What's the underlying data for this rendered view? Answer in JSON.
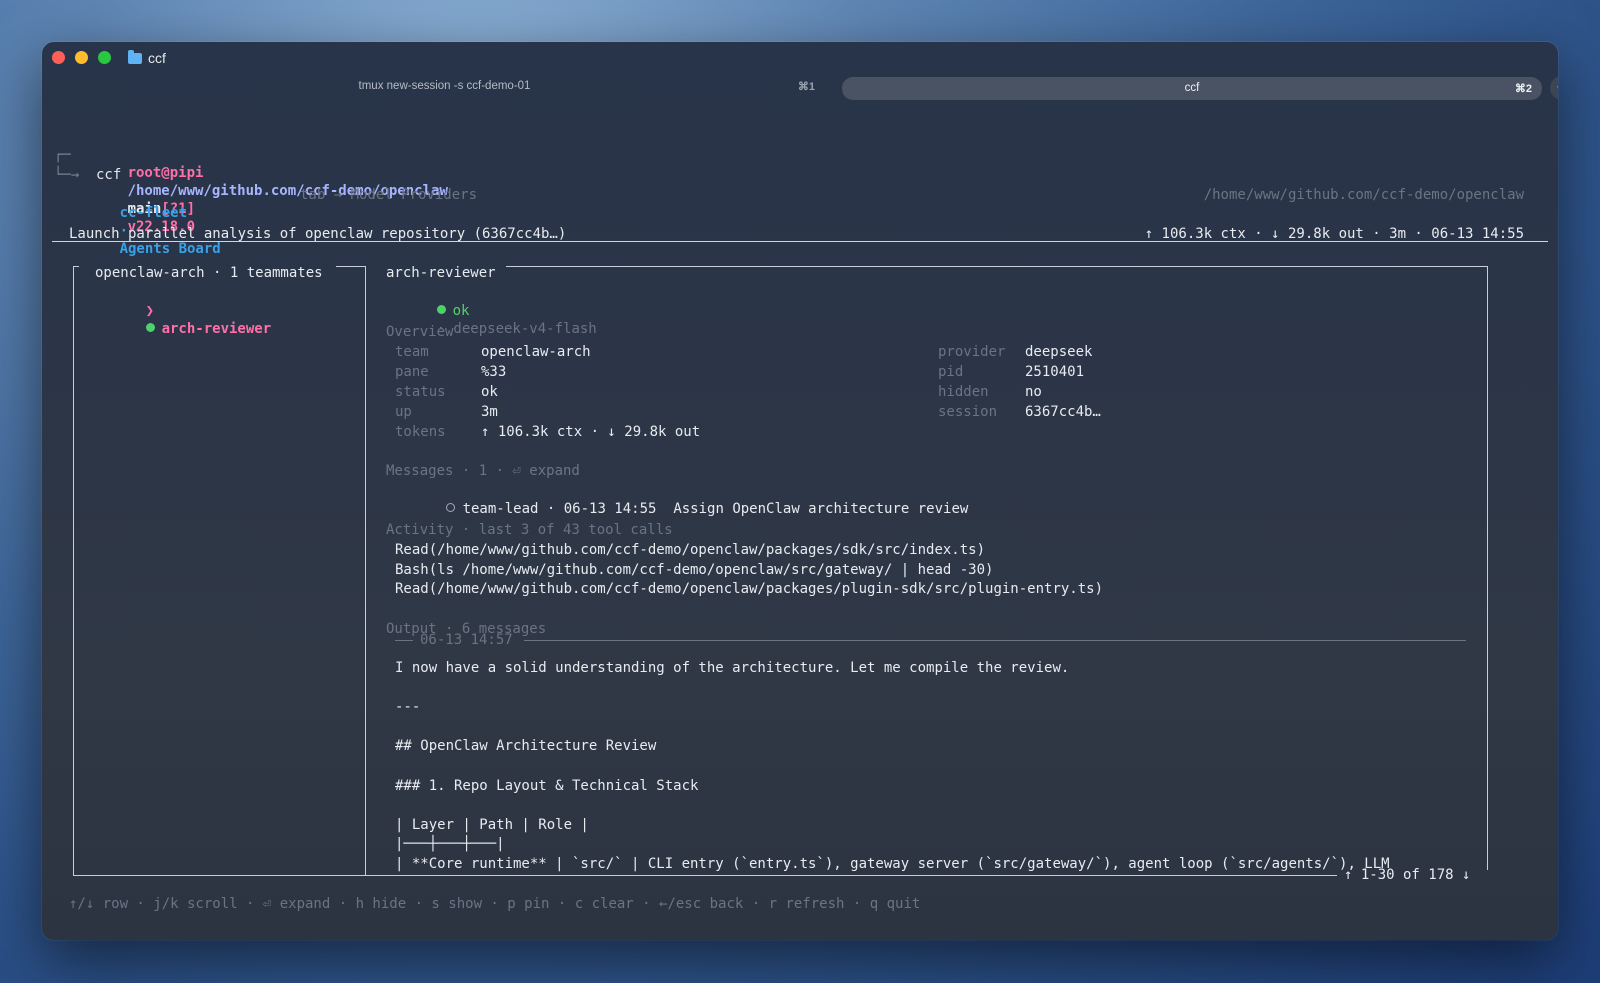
{
  "window": {
    "title": "ccf"
  },
  "tabs": [
    {
      "label": "tmux new-session -s ccf-demo-01",
      "shortcut": "⌘1",
      "active": false
    },
    {
      "label": "ccf",
      "shortcut": "⌘2",
      "active": true
    }
  ],
  "new_tab_label": "+",
  "prompt": {
    "corner_top": "┌─",
    "corner_bottom": "└─→",
    "user": "root@pipi",
    "path": "/home/www/github.com/ccf-demo/openclaw",
    "branch": "main",
    "git_status": "[?1]",
    "node_version": "v22.18.0",
    "command": "ccf"
  },
  "app": {
    "brand": "cc-fleet",
    "sep": "·",
    "board": "Agents Board",
    "tab_hint": "tab → Model Providers",
    "cwd": "/home/www/github.com/ccf-demo/openclaw"
  },
  "task": {
    "title": "Launch parallel analysis of openclaw repository (6367cc4b…)",
    "stats": "↑ 106.3k ctx · ↓ 29.8k out · 3m · 06-13 14:55"
  },
  "sidebar": {
    "team_title": "openclaw-arch · 1 teammates",
    "items": [
      {
        "caret": "❯",
        "name": "arch-reviewer",
        "status_color": "#4bd26b"
      }
    ]
  },
  "detail": {
    "title": "arch-reviewer",
    "status": "ok",
    "model": "· deepseek-v4-flash",
    "overview_heading": "Overview",
    "overview_left": [
      {
        "key": "team",
        "value": "openclaw-arch"
      },
      {
        "key": "pane",
        "value": "%33"
      },
      {
        "key": "status",
        "value": "ok"
      },
      {
        "key": "up",
        "value": "3m"
      },
      {
        "key": "tokens",
        "value": "↑ 106.3k ctx · ↓ 29.8k out"
      }
    ],
    "overview_right": [
      {
        "key": "provider",
        "value": "deepseek"
      },
      {
        "key": "pid",
        "value": "2510401"
      },
      {
        "key": "hidden",
        "value": "no"
      },
      {
        "key": "session",
        "value": "6367cc4b…"
      }
    ],
    "messages_heading": "Messages · 1 · ⏎ expand",
    "messages": [
      {
        "from": "team-lead · 06-13 14:55",
        "text": "Assign OpenClaw architecture review"
      }
    ],
    "activity_heading": "Activity · last 3 of 43 tool calls",
    "activity": [
      "Read(/home/www/github.com/ccf-demo/openclaw/packages/sdk/src/index.ts)",
      "Bash(ls /home/www/github.com/ccf-demo/openclaw/src/gateway/ | head -30)",
      "Read(/home/www/github.com/ccf-demo/openclaw/packages/plugin-sdk/src/plugin-entry.ts)"
    ],
    "output_heading": "Output · 6 messages",
    "output_timestamp": "06-13 14:57",
    "output_lines": [
      "I now have a solid understanding of the architecture. Let me compile the review.",
      "",
      "---",
      "",
      "## OpenClaw Architecture Review",
      "",
      "### 1. Repo Layout & Technical Stack",
      "",
      "| Layer | Path | Role |",
      "|───┼───┼───|",
      "| **Core runtime** | `src/` | CLI entry (`entry.ts`), gateway server (`src/gateway/`), agent loop (`src/agents/`), LLM"
    ],
    "scroll_position": "↑ 1-30 of 178 ↓"
  },
  "footer": {
    "hints": "↑/↓ row · j/k scroll · ⏎ expand · h hide · s show · p pin · c clear · ←/esc back · r refresh · q quit"
  }
}
